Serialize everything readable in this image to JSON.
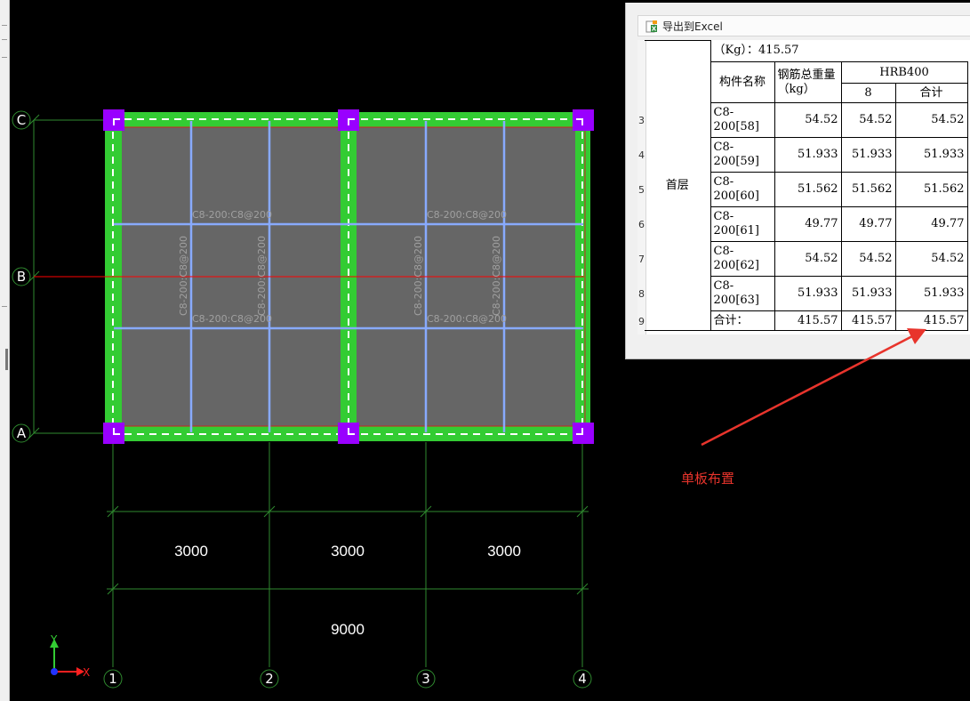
{
  "cad": {
    "axis_rows": [
      "C",
      "B",
      "A"
    ],
    "axis_cols": [
      "1",
      "2",
      "3",
      "4"
    ],
    "spans": [
      "3000",
      "3000",
      "3000"
    ],
    "total_span": "9000",
    "rebar_labels": [
      "C8-200:C8@200"
    ],
    "axis_x": "X",
    "axis_y": "Y",
    "colors": {
      "background": "#000000",
      "slab": "#666666",
      "beam": "#33cc33",
      "column": "#9900ff",
      "rebar": "#88aaff",
      "grid": "#2f8a2f",
      "axis_red": "#ff0000"
    }
  },
  "panel": {
    "export_label": "导出到Excel",
    "row_numbers": [
      "3",
      "4",
      "5",
      "6",
      "7",
      "8",
      "9"
    ],
    "header_total": "（Kg）：415.57",
    "col_component": "构件名称",
    "col_weight": "钢筋总重量（kg）",
    "col_group": "HRB400",
    "col_dia": "8",
    "col_sum": "合计",
    "floor": "首层",
    "rows": [
      {
        "name": "C8-200[58]",
        "total": "54.52",
        "d8": "54.52",
        "sum": "54.52"
      },
      {
        "name": "C8-200[59]",
        "total": "51.933",
        "d8": "51.933",
        "sum": "51.933"
      },
      {
        "name": "C8-200[60]",
        "total": "51.562",
        "d8": "51.562",
        "sum": "51.562"
      },
      {
        "name": "C8-200[61]",
        "total": "49.77",
        "d8": "49.77",
        "sum": "49.77"
      },
      {
        "name": "C8-200[62]",
        "total": "54.52",
        "d8": "54.52",
        "sum": "54.52"
      },
      {
        "name": "C8-200[63]",
        "total": "51.933",
        "d8": "51.933",
        "sum": "51.933"
      }
    ],
    "total_row": {
      "name": "合计：",
      "total": "415.57",
      "d8": "415.57",
      "sum": "415.57"
    }
  },
  "annotation": {
    "text": "单板布置",
    "color": "#e8342c"
  }
}
